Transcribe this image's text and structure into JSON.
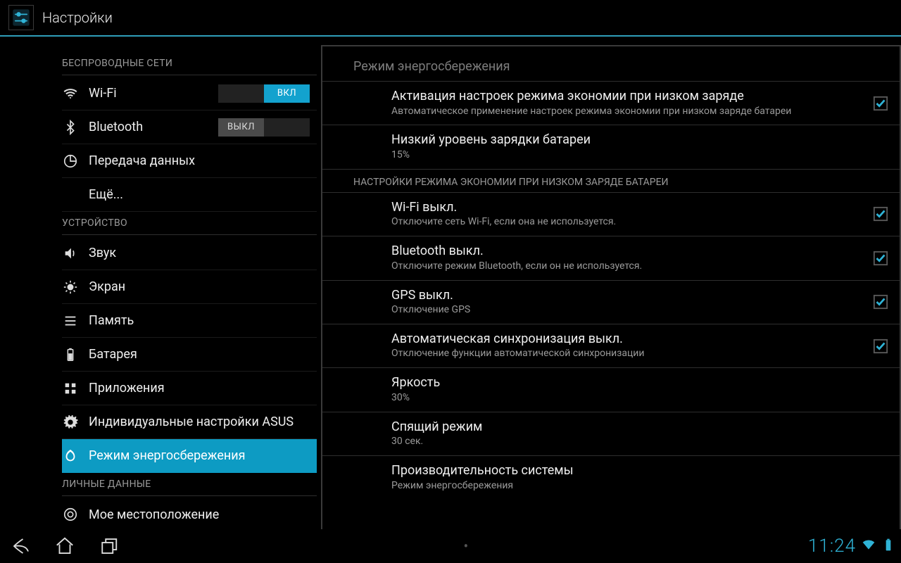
{
  "app_title": "Настройки",
  "toggles": {
    "on_label": "ВКЛ",
    "off_label": "ВЫКЛ"
  },
  "sidebar": {
    "sections": [
      {
        "title": "БЕСПРОВОДНЫЕ СЕТИ"
      },
      {
        "title": "УСТРОЙСТВО"
      },
      {
        "title": "ЛИЧНЫЕ ДАННЫЕ"
      }
    ],
    "wifi": "Wi-Fi",
    "bluetooth": "Bluetooth",
    "data_usage": "Передача данных",
    "more": "Ещё...",
    "sound": "Звук",
    "display": "Экран",
    "storage": "Память",
    "battery": "Батарея",
    "apps": "Приложения",
    "asus": "Индивидуальные настройки ASUS",
    "power": "Режим энергосбережения",
    "location": "Мое местоположение"
  },
  "detail": {
    "title": "Режим энергосбережения",
    "items": {
      "activation": {
        "title": "Активация настроек режима экономии при низком заряде",
        "summary": "Автоматическое применение настроек режима экономии при низком заряде батареи"
      },
      "level": {
        "title": "Низкий уровень зарядки батареи",
        "summary": "15%"
      },
      "section_low": "НАСТРОЙКИ РЕЖИМА ЭКОНОМИИ ПРИ НИЗКОМ ЗАРЯДЕ БАТАРЕИ",
      "wifi_off": {
        "title": "Wi-Fi выкл.",
        "summary": "Отключите сеть Wi-Fi, если она не используется."
      },
      "bt_off": {
        "title": "Bluetooth выкл.",
        "summary": "Отключите режим Bluetooth, если он не используется."
      },
      "gps_off": {
        "title": "GPS выкл.",
        "summary": "Отключение GPS"
      },
      "sync_off": {
        "title": "Автоматическая синхронизация выкл.",
        "summary": "Отключение функции автоматической синхронизации"
      },
      "brightness": {
        "title": "Яркость",
        "summary": "30%"
      },
      "sleep": {
        "title": "Спящий режим",
        "summary": "30 сек."
      },
      "perf": {
        "title": "Производительность системы",
        "summary": "Режим энергосбережения"
      }
    }
  },
  "sysbar": {
    "clock": "11:24"
  },
  "colors": {
    "accent": "#0d9bc3",
    "divider_blue": "#2f9db9",
    "text_muted": "#9a9a9a"
  }
}
